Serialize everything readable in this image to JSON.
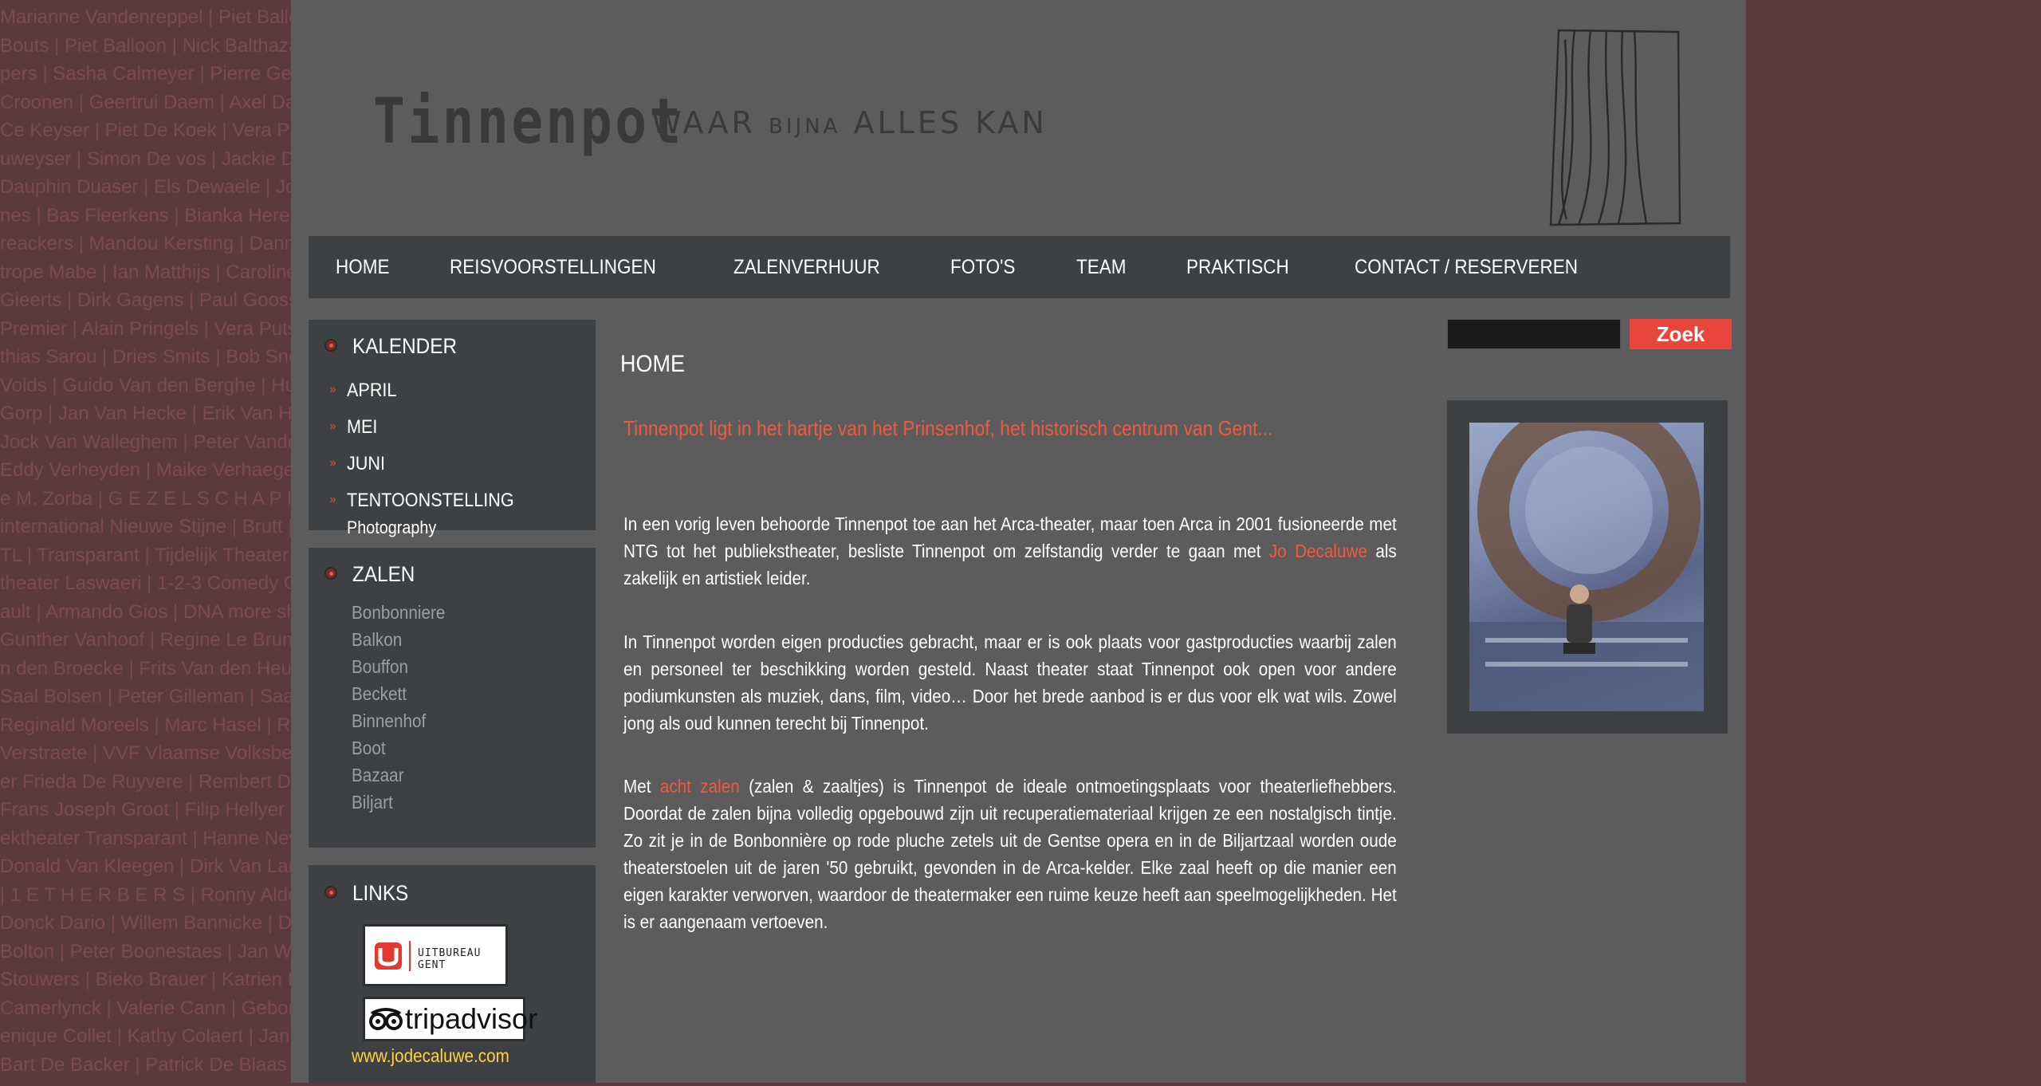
{
  "background_names": [
    "Marianne Vandenreppel | Piet Balloon | Nick Balthazar | Marieke Dermul | Laura | Ann Ceulemans | Marianne Vandenreppel | Piet Balloon | Nick Balthazar | Marieke",
    "Bouts | Piet Balloon | Nick Balthazar | Marieke Dermul | Laura | Ann Ceulemans | Griet Op De Beeck | Piet Balloon | Nick Balthazar | Ma",
    "pers | Sasha Calmeyer | Pierre Geldhof | Koen De Sutter | Peter Van den Eede | Gert Jan | Maaike Calmeyer | Pierre Geldhof",
    "Croonen | Geertrui Daem | Axel Daeseleire | Jan Van Hecke | Fons Van de Velde | Karel Deruwe | k Croonen | Geertrui Daem | Axel Da",
    "Ce Keyser | Piet De Koek | Vera Puts | Jo Decaluwe | Martine Jonckheere | Geert De Keyser | Piet De Koek | Dirk De Keyser | Piet De Ko",
    "uweyser | Simon De vos | Jackie De Wilde | Ivo Pauwels | Bruno Vanden Broecke | Simon De vos | Jackie De W",
    "Dauphin Duaser | Els Dewaele | Joke Devynck | Jef Demedts | Sandrine | Dauphin Duaser | Els Deveinder | Joke De",
    "nes | Bas Fleerkens | Bianka Heremans | Pim Wouters | Lucas Van den Eynde | nes | Bas Fleerkens | Bianka Herm",
    "reackers | Mandou Kersting | Danny Kennes | Valentijn Dhaenens | reackers | Mandou Kersting | Danny Ke",
    "trope Mabe | Ian Matthijs | Caroline Maes | Tine Van den Wyngaert | trope Mabe | Ian Matthijs | Caroline M",
    "Gieerts | Dirk Gagens | Paul Goossens | Peter De Graef | Gieerts | Dirk Gagens | Paul Gooss",
    "Premier | Alain Pringels | Vera Puts | Marc Peeters | Premier | Alain Pringels | Vera Puts",
    "thias Sarou | Dries Smits | Bob Snellinckx | Ingrid De Vos | thias Sarou | Dries Smits | Bob Snellin",
    "Volds | Guido Van den Berghe | Hugo Van den Berghe | Volds | Guido Van den Berghe | Hug",
    "Gorp | Jan Van Hecke | Erik Van Herreweghe | Van Gorp | Jan Van Hecke | Erik Van Herre",
    "Jock Van Walleghem | Peter Vande Velde | Jock Van Walleghem | Peter Vand",
    "Eddy Verheyden | Maike Verhaegen | Eddy Verheyden | Maike Verhaegen",
    "e M. Zorba | G E Z E L S C H A P P E N | e M. Zorba | G E Z E L S C H A P P E N",
    "international Nieuwe Stijne | Brutt | International Nieuwe Stijne | Brutt",
    "TL | Transparant | Tijdelijk Theater Gent | TL | Transparant | Tijdelijk Theater Gent",
    "theater Laswaeri | 1-2-3 Comedy Club | theater Laswaeri | 1-2-3 Comedy Club",
    "ault | Armando Gios | DNA more show | ault | Armando Gios | DNA more show",
    "Gunther Vanhoof | Regine Le Brun | Gunther Vanhoof | Regine Le Brun",
    "n den Broecke | Frits Van den Heuvel | n den Broecke | Frits Van den Heuvel",
    "Saal Bolsen | Peter Gilleman | Saal Bolsen | Peter Gilleman",
    "Reginald Moreels | Marc Hasel | Reginald Moreels | Marc Hasel",
    "Verstraete | VVF Vlaamse Volksbewegingen | Verstraete | VVF Vlaamse",
    "er Frieda De Ruyvere | Rembert De Smet | er Frieda De Ruyvere | Rembert De Smet",
    "Frans Joseph Groot | Filip Hellyer | Frans Joseph Groot | Filip Hellyer",
    "ektheater Transparant | Hanne Newmann | ektheater Transparant | Hanne Newmann",
    "Donald Van Kleegen | Dirk Van Landeghem | Donald Van Kleegen | Dirk Van",
    "| 1 E T H E R B E R S | Ronny Aldeman | | 1 E T H E R B E R S | Ronny",
    "Donck Dario | Willem Bannicke | Donck Dario | Willem Bannicke",
    "Bolton | Peter Boonestaes | Jan Willem | Bolton | Peter Boonestaes | Jan",
    "Stouwers | Bieko Brauer | Katrien Broes | Stouwers | Bieko Brauer | Katrien",
    "Camerlynck | Valerie Cann | Gebon Camerlynck | Valerie Cann",
    "enique Collet | Kathy Colaert | Jannes | enique Collet | Kathy Colaert",
    "Bart De Backer | Patrick De Blaas | Bart De Backer | Patrick De Blaas"
  ],
  "logo": {
    "word": "Tinnenpot",
    "tag_part1": "WAAR",
    "tag_part2": "BIJNA",
    "tag_part3": "ALLES KAN"
  },
  "nav": [
    "HOME",
    "REISVOORSTELLINGEN",
    "ZALENVERHUUR",
    "FOTO'S",
    "TEAM",
    "PRAKTISCH",
    "CONTACT / RESERVEREN"
  ],
  "kalender": {
    "title": "KALENDER",
    "items": [
      "APRIL",
      "MEI",
      "JUNI",
      "TENTOONSTELLING"
    ],
    "sub": "Photography"
  },
  "zalen": {
    "title": "ZALEN",
    "items": [
      "Bonbonniere",
      "Balkon",
      "Bouffon",
      "Beckett",
      "Binnenhof",
      "Boot",
      "Bazaar",
      "Biljart"
    ]
  },
  "links": {
    "title": "LINKS",
    "uit_text_u": "U",
    "uit_text_name": "UITBUREAU GENT",
    "trip_text": "tripadvisor",
    "url": "www.jodecaluwe.com"
  },
  "main": {
    "title": "HOME",
    "intro": "Tinnenpot ligt in het hartje van het Prinsenhof, het historisch centrum van Gent...",
    "p1_before": "In een vorig leven behoorde Tinnenpot toe aan het Arca-theater, maar toen Arca in 2001 fusioneerde met NTG tot het publiekstheater, besliste Tinnenpot om zelfstandig verder te gaan met ",
    "p1_link": "Jo Decaluwe",
    "p1_after": " als zakelijk en artistiek leider.",
    "p2": "In Tinnenpot worden eigen producties gebracht, maar er is ook plaats voor gastproducties waarbij zalen en personeel ter beschikking worden gesteld. Naast theater staat Tinnenpot ook open voor andere podiumkunsten als muziek, dans, film, video… Door het brede aanbod is er dus voor elk wat wils. Zowel jong als oud kunnen terecht bij Tinnenpot.",
    "p3_before": "Met ",
    "p3_link": "acht zalen",
    "p3_after": " (zalen & zaaltjes) is Tinnenpot de ideale ontmoetingsplaats voor theaterliefhebbers. Doordat de zalen bijna volledig opgebouwd zijn uit recuperatiemateriaal krijgen ze een nostalgisch tintje. Zo zit je in de Bonbonnière op rode pluche zetels uit de Gentse opera en in de Biljartzaal worden oude theaterstoelen uit de jaren '50 gebruikt, gevonden in de Arca-kelder. Elke zaal heeft op die manier een eigen karakter verworven, waardoor de theatermaker een ruime keuze heeft aan speelmogelijkheden. Het is er aangenaam vertoeven."
  },
  "search": {
    "value": "",
    "button_label": "Zoek"
  },
  "colors": {
    "accent": "#ef5a3c",
    "search_button": "#e8453c",
    "link_yellow": "#ffd23a",
    "panel": "#3e4143"
  }
}
